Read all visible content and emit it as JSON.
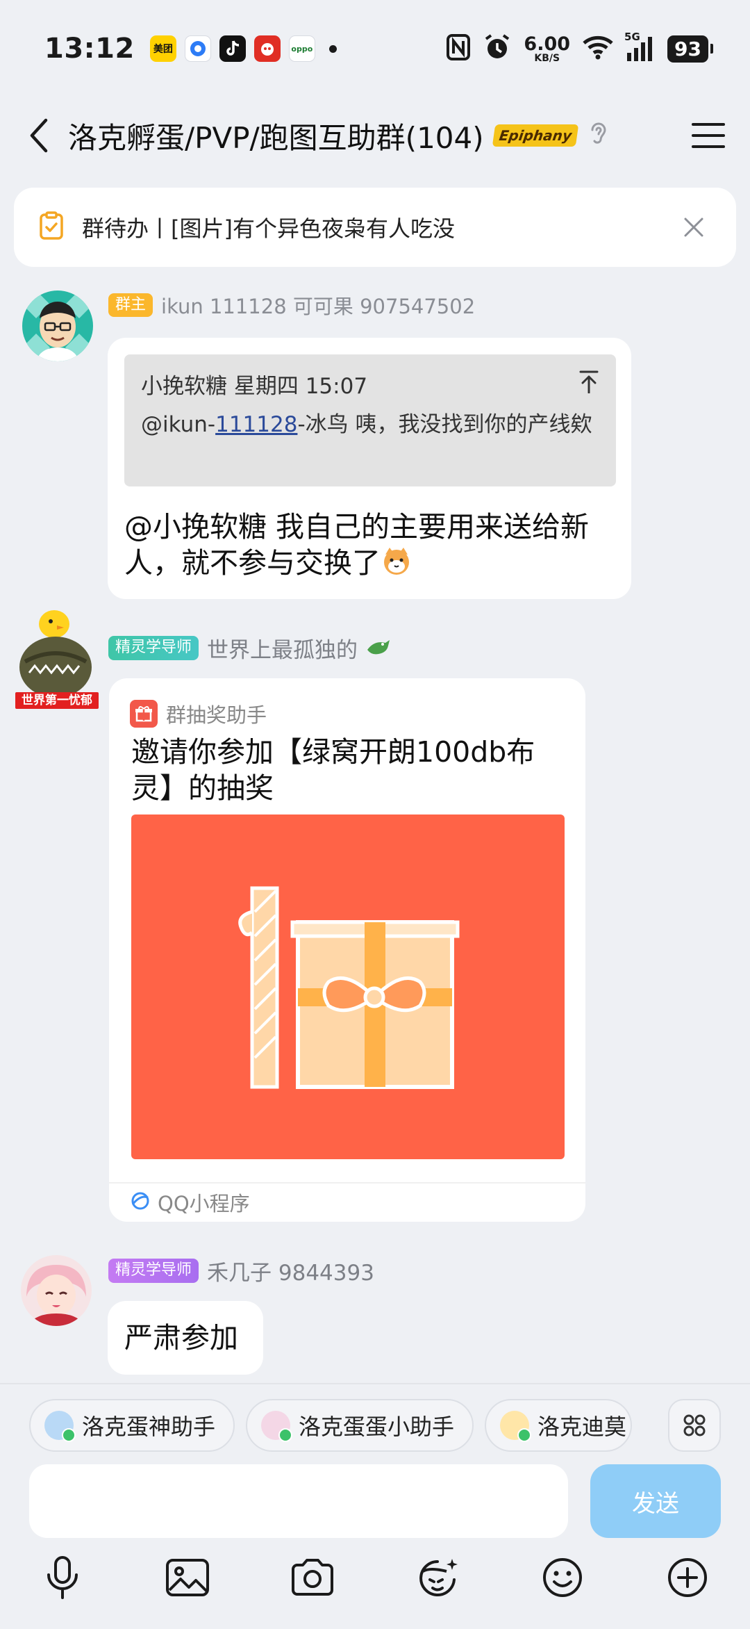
{
  "status_bar": {
    "time": "13:12",
    "apps": [
      "美团",
      "百度",
      "抖音",
      "拼多多",
      "oppo"
    ],
    "net_speed_value": "6.00",
    "net_speed_unit": "KB/S",
    "network": "5G",
    "battery": "93"
  },
  "header": {
    "title": "洛克孵蛋/PVP/跑图互助群(104)",
    "badge": "Epiphany"
  },
  "todo": {
    "text": "群待办丨[图片]有个异色夜枭有人吃没"
  },
  "messages": [
    {
      "role": "群主",
      "sender": "ikun 111128 可可果 907547502",
      "quote": {
        "author_time": "小挽软糖 星期四 15:07",
        "prefix": "@ikun-",
        "link": "111128",
        "suffix": "-冰鸟 咦，我没找到你的产线欸"
      },
      "text": "@小挽软糖 我自己的主要用来送给新人，就不参与交换了"
    },
    {
      "role": "精灵学导师",
      "sender": "世界上最孤独的",
      "avatar_caption": "世界第一忧郁",
      "card": {
        "source": "群抽奖助手",
        "title": "邀请你参加【绿窝开朗100db布灵】的抽奖",
        "footer": "QQ小程序"
      }
    },
    {
      "role": "精灵学导师",
      "sender": "禾几子 9844393",
      "text": "严肃参加"
    }
  ],
  "bots": [
    "洛克蛋神助手",
    "洛克蛋蛋小助手",
    "洛克迪莫"
  ],
  "input": {
    "send_label": "发送"
  },
  "colors": {
    "accent": "#8fcdf7",
    "owner_tag": "#fbb72c",
    "card_image": "#ff6347"
  }
}
